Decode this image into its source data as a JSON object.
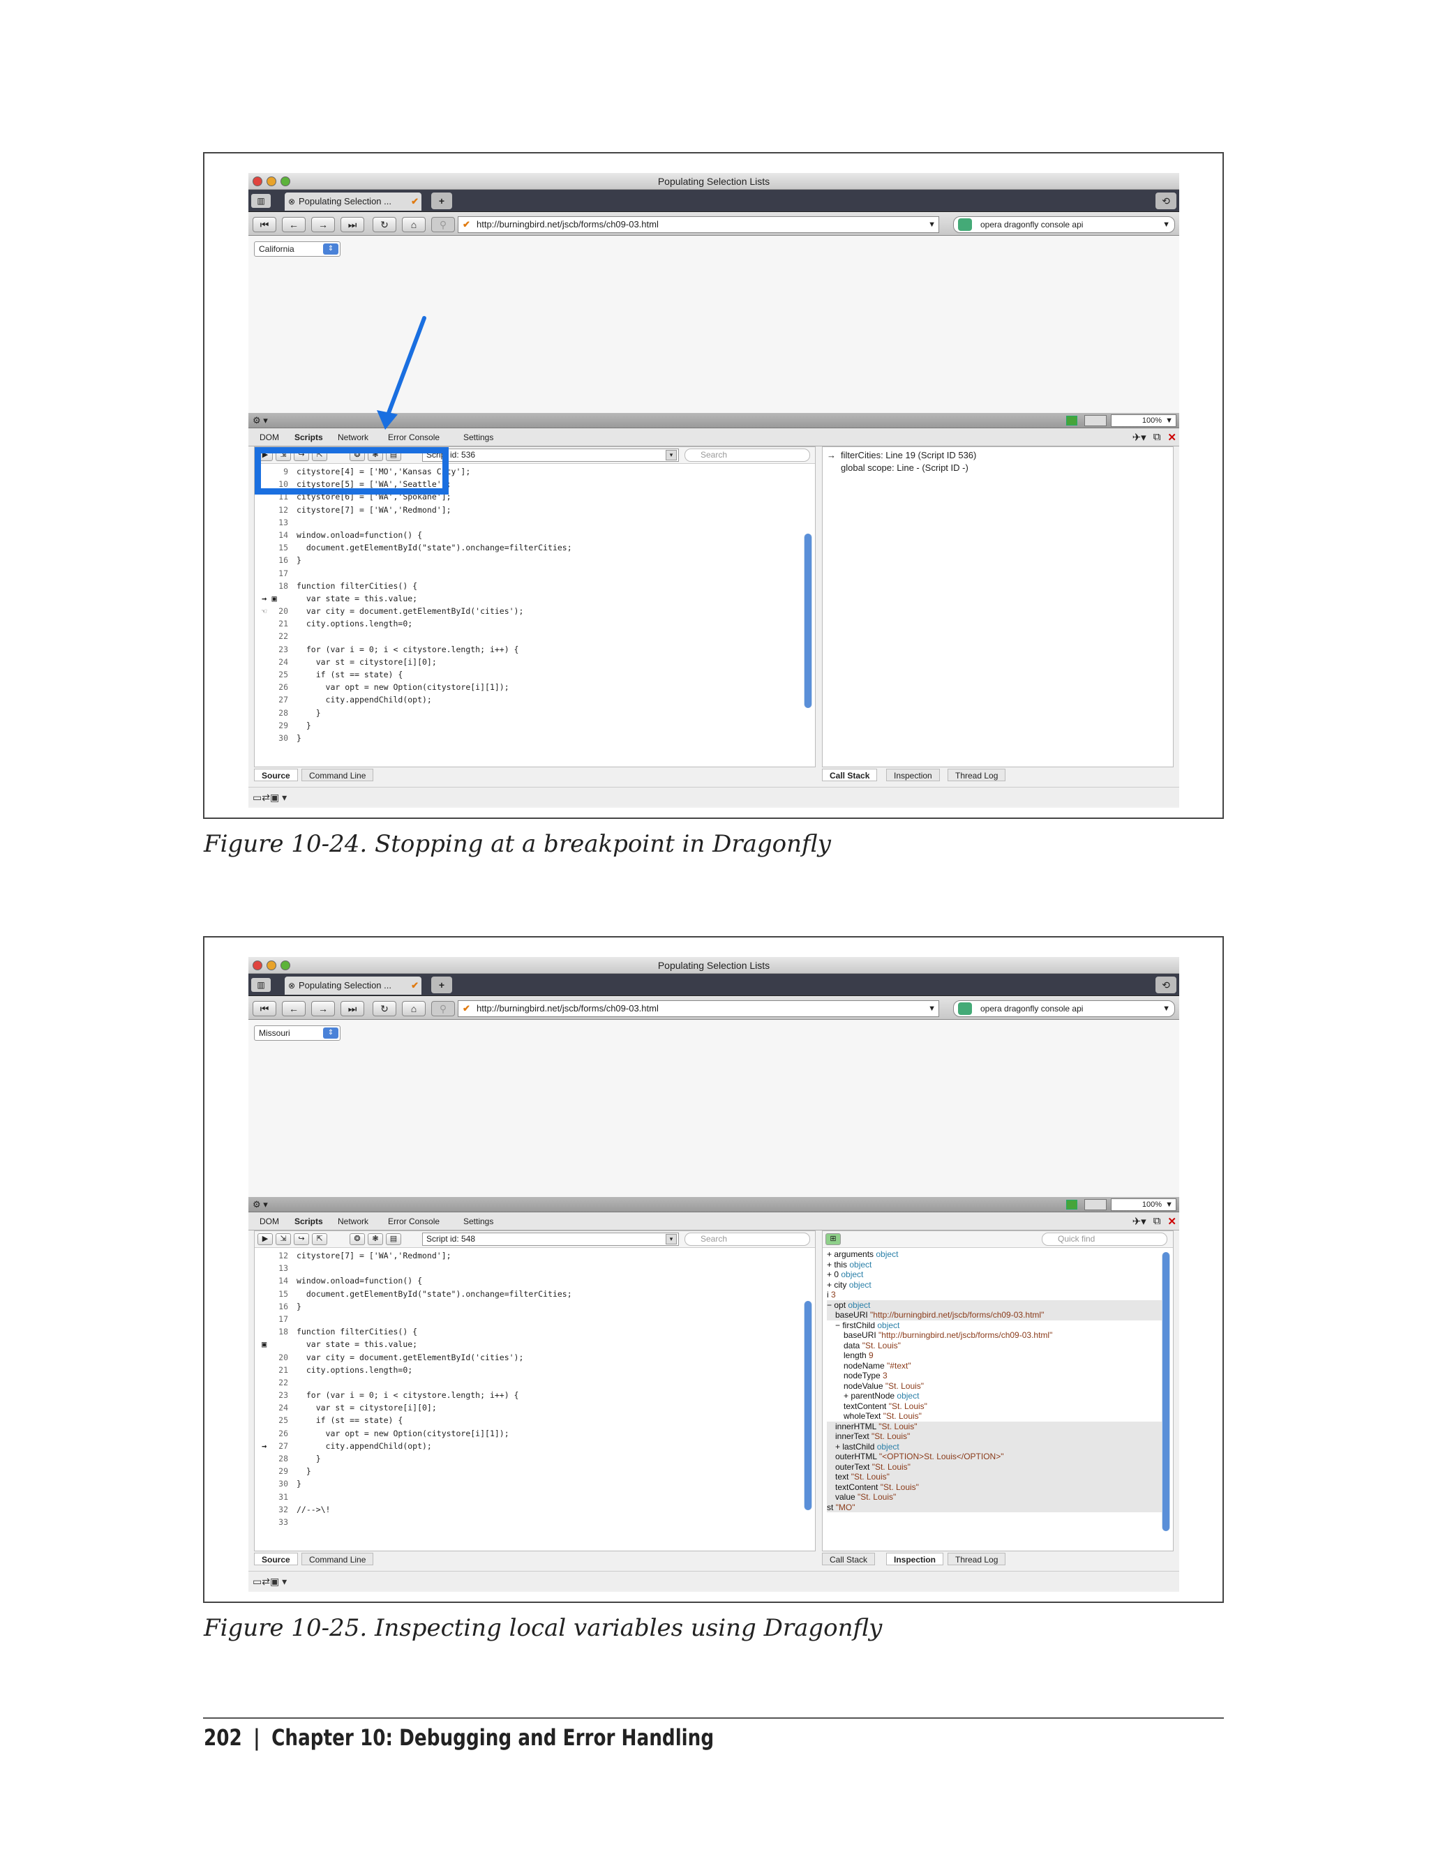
{
  "figure1": {
    "caption": "Figure 10-24. Stopping at a breakpoint in Dragonfly",
    "window_title": "Populating Selection Lists",
    "tab_title": "Populating Selection ...",
    "url": "http://burningbird.net/jscb/forms/ch09-03.html",
    "search_engine_text": "opera dragonfly console api",
    "select_value": "California",
    "zoom": "100%",
    "dev_tabs": [
      "DOM",
      "Scripts",
      "Network",
      "Error Console",
      "Settings"
    ],
    "script_id": "Script id: 536",
    "search_placeholder": "Search",
    "code_lines": [
      {
        "n": "9",
        "t": "citystore[4] = ['MO','Kansas City'];",
        "m": ""
      },
      {
        "n": "10",
        "t": "citystore[5] = ['WA','Seattle'];",
        "m": ""
      },
      {
        "n": "11",
        "t": "citystore[6] = ['WA','Spokane'];",
        "m": ""
      },
      {
        "n": "12",
        "t": "citystore[7] = ['WA','Redmond'];",
        "m": ""
      },
      {
        "n": "13",
        "t": "",
        "m": ""
      },
      {
        "n": "14",
        "t": "window.onload=function() {",
        "m": ""
      },
      {
        "n": "15",
        "t": "  document.getElementById(\"state\").onchange=filterCities;",
        "m": ""
      },
      {
        "n": "16",
        "t": "}",
        "m": ""
      },
      {
        "n": "17",
        "t": "",
        "m": ""
      },
      {
        "n": "18",
        "t": "function filterCities() {",
        "m": ""
      },
      {
        "n": "",
        "t": "  var state = this.value;",
        "m": "→ ▣"
      },
      {
        "n": "20",
        "t": "  var city = document.getElementById('cities');",
        "m": "☜"
      },
      {
        "n": "21",
        "t": "  city.options.length=0;",
        "m": ""
      },
      {
        "n": "22",
        "t": "",
        "m": ""
      },
      {
        "n": "23",
        "t": "  for (var i = 0; i < citystore.length; i++) {",
        "m": ""
      },
      {
        "n": "24",
        "t": "    var st = citystore[i][0];",
        "m": ""
      },
      {
        "n": "25",
        "t": "    if (st == state) {",
        "m": ""
      },
      {
        "n": "26",
        "t": "      var opt = new Option(citystore[i][1]);",
        "m": ""
      },
      {
        "n": "27",
        "t": "      city.appendChild(opt);",
        "m": ""
      },
      {
        "n": "28",
        "t": "    }",
        "m": ""
      },
      {
        "n": "29",
        "t": "  }",
        "m": ""
      },
      {
        "n": "30",
        "t": "}",
        "m": ""
      }
    ],
    "call_stack": [
      "filterCities: Line 19 (Script ID 536)",
      "global scope: Line - (Script ID -)"
    ],
    "left_bottom_tabs": [
      "Source",
      "Command Line"
    ],
    "right_bottom_tabs": [
      "Call Stack",
      "Inspection",
      "Thread Log"
    ],
    "highlight_color": "#1a6fe0"
  },
  "figure2": {
    "caption": "Figure 10-25. Inspecting local variables using Dragonfly",
    "window_title": "Populating Selection Lists",
    "tab_title": "Populating Selection ...",
    "url": "http://burningbird.net/jscb/forms/ch09-03.html",
    "search_engine_text": "opera dragonfly console api",
    "select_value": "Missouri",
    "zoom": "100%",
    "dev_tabs": [
      "DOM",
      "Scripts",
      "Network",
      "Error Console",
      "Settings"
    ],
    "script_id": "Script id: 548",
    "search_placeholder": "Search",
    "quick_find_placeholder": "Quick find",
    "code_lines": [
      {
        "n": "12",
        "t": "citystore[7] = ['WA','Redmond'];",
        "m": ""
      },
      {
        "n": "13",
        "t": "",
        "m": ""
      },
      {
        "n": "14",
        "t": "window.onload=function() {",
        "m": ""
      },
      {
        "n": "15",
        "t": "  document.getElementById(\"state\").onchange=filterCities;",
        "m": ""
      },
      {
        "n": "16",
        "t": "}",
        "m": ""
      },
      {
        "n": "17",
        "t": "",
        "m": ""
      },
      {
        "n": "18",
        "t": "function filterCities() {",
        "m": ""
      },
      {
        "n": "",
        "t": "  var state = this.value;",
        "m": "▣"
      },
      {
        "n": "20",
        "t": "  var city = document.getElementById('cities');",
        "m": ""
      },
      {
        "n": "21",
        "t": "  city.options.length=0;",
        "m": ""
      },
      {
        "n": "22",
        "t": "",
        "m": ""
      },
      {
        "n": "23",
        "t": "  for (var i = 0; i < citystore.length; i++) {",
        "m": ""
      },
      {
        "n": "24",
        "t": "    var st = citystore[i][0];",
        "m": ""
      },
      {
        "n": "25",
        "t": "    if (st == state) {",
        "m": ""
      },
      {
        "n": "26",
        "t": "      var opt = new Option(citystore[i][1]);",
        "m": ""
      },
      {
        "n": "27",
        "t": "      city.appendChild(opt);",
        "m": "→"
      },
      {
        "n": "28",
        "t": "    }",
        "m": ""
      },
      {
        "n": "29",
        "t": "  }",
        "m": ""
      },
      {
        "n": "30",
        "t": "}",
        "m": ""
      },
      {
        "n": "31",
        "t": "",
        "m": ""
      },
      {
        "n": "32",
        "t": "//-->\\!",
        "m": ""
      },
      {
        "n": "33",
        "t": "",
        "m": ""
      }
    ],
    "inspection": [
      {
        "k": "+ arguments",
        "v": "object",
        "c": "o",
        "indent": 0,
        "band": false
      },
      {
        "k": "+ this",
        "v": "object",
        "c": "o",
        "indent": 0,
        "band": false
      },
      {
        "k": "+ 0",
        "v": "object",
        "c": "o",
        "indent": 0,
        "band": false
      },
      {
        "k": "+ city",
        "v": "object",
        "c": "o",
        "indent": 0,
        "band": false
      },
      {
        "k": "i",
        "v": "3",
        "c": "v",
        "indent": 0,
        "band": false
      },
      {
        "k": "− opt",
        "v": "object",
        "c": "o",
        "indent": 0,
        "band": true
      },
      {
        "k": "baseURI",
        "v": "\"http://burningbird.net/jscb/forms/ch09-03.html\"",
        "c": "v",
        "indent": 1,
        "band": true
      },
      {
        "k": "− firstChild",
        "v": "object",
        "c": "o",
        "indent": 1,
        "band": false
      },
      {
        "k": "baseURI",
        "v": "\"http://burningbird.net/jscb/forms/ch09-03.html\"",
        "c": "v",
        "indent": 2,
        "band": false
      },
      {
        "k": "data",
        "v": "\"St. Louis\"",
        "c": "v",
        "indent": 2,
        "band": false
      },
      {
        "k": "length",
        "v": "9",
        "c": "v",
        "indent": 2,
        "band": false
      },
      {
        "k": "nodeName",
        "v": "\"#text\"",
        "c": "v",
        "indent": 2,
        "band": false
      },
      {
        "k": "nodeType",
        "v": "3",
        "c": "v",
        "indent": 2,
        "band": false
      },
      {
        "k": "nodeValue",
        "v": "\"St. Louis\"",
        "c": "v",
        "indent": 2,
        "band": false
      },
      {
        "k": "+ parentNode",
        "v": "object",
        "c": "o",
        "indent": 2,
        "band": false
      },
      {
        "k": "textContent",
        "v": "\"St. Louis\"",
        "c": "v",
        "indent": 2,
        "band": false
      },
      {
        "k": "wholeText",
        "v": "\"St. Louis\"",
        "c": "v",
        "indent": 2,
        "band": false
      },
      {
        "k": "innerHTML",
        "v": "\"St. Louis\"",
        "c": "v",
        "indent": 1,
        "band": true
      },
      {
        "k": "innerText",
        "v": "\"St. Louis\"",
        "c": "v",
        "indent": 1,
        "band": true
      },
      {
        "k": "+ lastChild",
        "v": "object",
        "c": "o",
        "indent": 1,
        "band": true
      },
      {
        "k": "outerHTML",
        "v": "\"<OPTION>St. Louis</OPTION>\"",
        "c": "v",
        "indent": 1,
        "band": true
      },
      {
        "k": "outerText",
        "v": "\"St. Louis\"",
        "c": "v",
        "indent": 1,
        "band": true
      },
      {
        "k": "text",
        "v": "\"St. Louis\"",
        "c": "v",
        "indent": 1,
        "band": true
      },
      {
        "k": "textContent",
        "v": "\"St. Louis\"",
        "c": "v",
        "indent": 1,
        "band": true
      },
      {
        "k": "value",
        "v": "\"St. Louis\"",
        "c": "v",
        "indent": 1,
        "band": true
      },
      {
        "k": "st",
        "v": "\"MO\"",
        "c": "v",
        "indent": 0,
        "band": true
      }
    ],
    "left_bottom_tabs": [
      "Source",
      "Command Line"
    ],
    "right_bottom_tabs": [
      "Call Stack",
      "Inspection",
      "Thread Log"
    ]
  },
  "footer": {
    "page_number": "202",
    "separator": "|",
    "chapter": "Chapter 10:   Debugging and Error Handling"
  }
}
